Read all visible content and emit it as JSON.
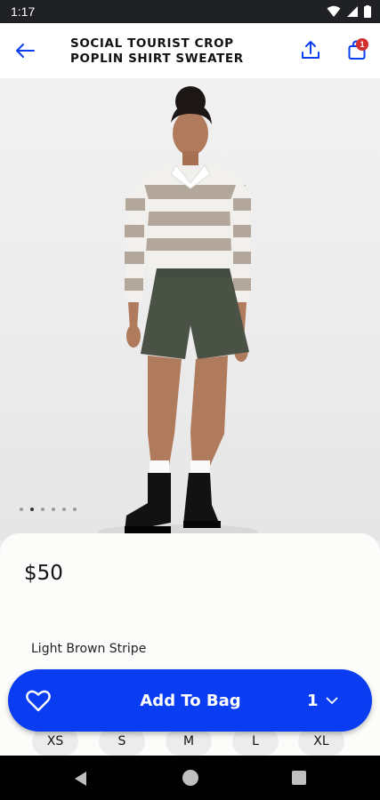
{
  "status_bar": {
    "time": "1:17"
  },
  "header": {
    "title_line1": "SOCIAL TOURIST CROP",
    "title_line2": "POPLIN SHIRT SWEATER",
    "bag_count": "1"
  },
  "gallery": {
    "image_count": 6,
    "active_index": 1
  },
  "product": {
    "price": "$50",
    "color": "Light Brown Stripe"
  },
  "cta": {
    "add_label": "Add To Bag",
    "quantity": "1"
  },
  "sizes": [
    "XS",
    "S",
    "M",
    "L",
    "XL"
  ],
  "colors": {
    "accent": "#0a3cf2",
    "badge": "#d32f2f"
  }
}
